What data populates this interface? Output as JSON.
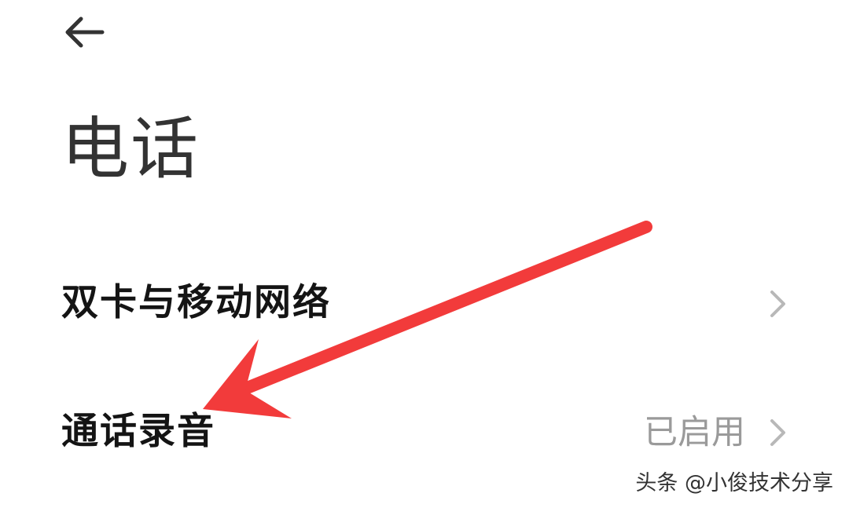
{
  "header": {
    "back_icon": "arrow-left-icon",
    "title": "电话"
  },
  "settings": [
    {
      "label": "双卡与移动网络",
      "value": "",
      "chevron_icon": "chevron-right-icon"
    },
    {
      "label": "通话录音",
      "value": "已启用",
      "chevron_icon": "chevron-right-icon"
    }
  ],
  "annotation": {
    "arrow_color": "#f23b3b"
  },
  "watermark": {
    "text": "头条 @小俊技术分享"
  },
  "colors": {
    "background": "#ffffff",
    "title_text": "#333333",
    "row_text": "#141414",
    "secondary_text": "#9a9a9a",
    "chevron": "#b8b8b8"
  }
}
